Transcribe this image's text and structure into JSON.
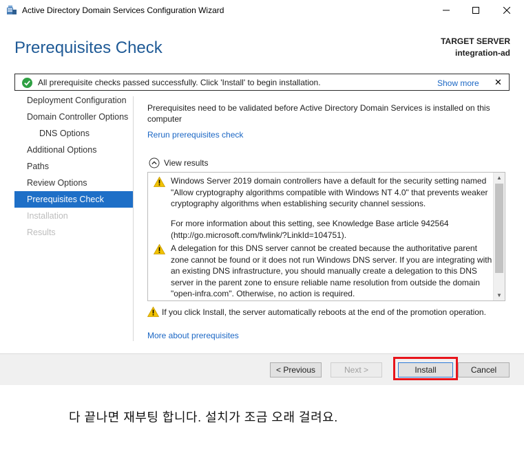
{
  "window": {
    "title": "Active Directory Domain Services Configuration Wizard",
    "icon": "ad-server-icon"
  },
  "header": {
    "page_title": "Prerequisites Check",
    "target_label": "TARGET SERVER",
    "target_name": "integration-ad"
  },
  "notification": {
    "message": "All prerequisite checks passed successfully.  Click 'Install' to begin installation.",
    "show_more": "Show more",
    "close": "✕"
  },
  "nav": {
    "items": [
      {
        "label": "Deployment Configuration",
        "state": "normal"
      },
      {
        "label": "Domain Controller Options",
        "state": "normal"
      },
      {
        "label": "DNS Options",
        "state": "sub"
      },
      {
        "label": "Additional Options",
        "state": "normal"
      },
      {
        "label": "Paths",
        "state": "normal"
      },
      {
        "label": "Review Options",
        "state": "normal"
      },
      {
        "label": "Prerequisites Check",
        "state": "active"
      },
      {
        "label": "Installation",
        "state": "disabled"
      },
      {
        "label": "Results",
        "state": "disabled"
      }
    ]
  },
  "content": {
    "intro": "Prerequisites need to be validated before Active Directory Domain Services is installed on this computer",
    "rerun_link": "Rerun prerequisites check",
    "view_results": "View results",
    "results": [
      {
        "text": "Windows Server 2019 domain controllers have a default for the security setting named \"Allow cryptography algorithms compatible with Windows NT 4.0\" that prevents weaker cryptography algorithms when establishing security channel sessions.",
        "icon": "warning-icon"
      },
      {
        "text": "For more information about this setting, see Knowledge Base article 942564 (http://go.microsoft.com/fwlink/?LinkId=104751).",
        "icon": ""
      },
      {
        "text": "A delegation for this DNS server cannot be created because the authoritative parent zone cannot be found or it does not run Windows DNS server. If you are integrating with an existing DNS infrastructure, you should manually create a delegation to this DNS server in the parent zone to ensure reliable name resolution from outside the domain \"open-infra.com\". Otherwise, no action is required.",
        "icon": "warning-icon"
      }
    ],
    "reboot_note": "If you click Install, the server automatically reboots at the end of the promotion operation.",
    "more_link": "More about prerequisites"
  },
  "footer": {
    "previous": "< Previous",
    "next": "Next >",
    "install": "Install",
    "cancel": "Cancel"
  },
  "caption": "다 끝나면 재부팅 합니다. 설치가 조금 오래 걸려요.",
  "colors": {
    "accent": "#1e6fc7",
    "title": "#1f5a96",
    "link": "#1a66c4",
    "highlight": "#e8141b",
    "success": "#2ea043",
    "warning": "#f2c200"
  }
}
